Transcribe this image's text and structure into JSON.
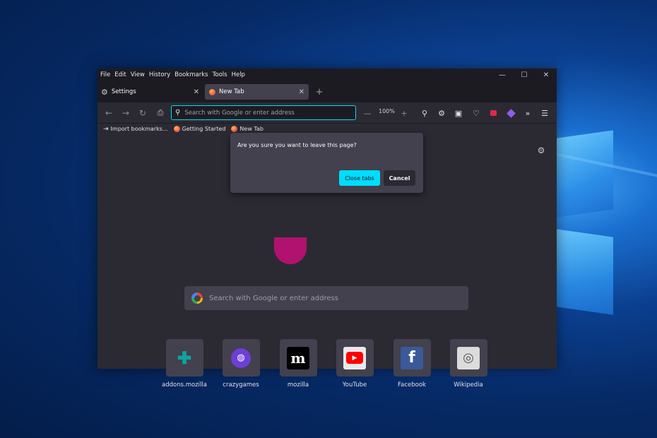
{
  "menubar": {
    "items": [
      "File",
      "Edit",
      "View",
      "History",
      "Bookmarks",
      "Tools",
      "Help"
    ]
  },
  "window_controls": {
    "minimize": "—",
    "maximize": "☐",
    "close": "✕"
  },
  "tabs": [
    {
      "label": "Settings",
      "icon": "gear-icon",
      "active": false
    },
    {
      "label": "New Tab",
      "icon": "firefox-icon",
      "active": true
    }
  ],
  "new_tab_glyph": "+",
  "urlbar": {
    "placeholder": "Search with Google or enter address"
  },
  "zoom": {
    "value": "100%"
  },
  "bookmarks": [
    {
      "label": "Import bookmarks...",
      "icon": "import-icon"
    },
    {
      "label": "Getting Started",
      "icon": "firefox-icon"
    },
    {
      "label": "New Tab",
      "icon": "firefox-icon"
    }
  ],
  "dialog": {
    "message": "Are you sure you want to leave this page?",
    "primary_label": "Close tabs",
    "secondary_label": "Cancel"
  },
  "search": {
    "placeholder": "Search with Google or enter address"
  },
  "top_sites": [
    {
      "label": "addons.mozilla",
      "icon": "puzzle-icon",
      "color": "#0aa5a5"
    },
    {
      "label": "crazygames",
      "icon": "crazygames-icon",
      "color": "#6d3fd6"
    },
    {
      "label": "mozilla",
      "icon": "mozilla-m-icon",
      "color": "#000000"
    },
    {
      "label": "YouTube",
      "icon": "youtube-icon",
      "color": "#ff0000"
    },
    {
      "label": "Facebook",
      "icon": "facebook-icon",
      "color": "#3b5998"
    },
    {
      "label": "Wikipedia",
      "icon": "wikipedia-icon",
      "color": "#dcdcdc"
    }
  ],
  "colors": {
    "accent": "#00ddff",
    "frame": "#1c1b22",
    "content": "#2b2a33",
    "surface": "#42414d"
  }
}
